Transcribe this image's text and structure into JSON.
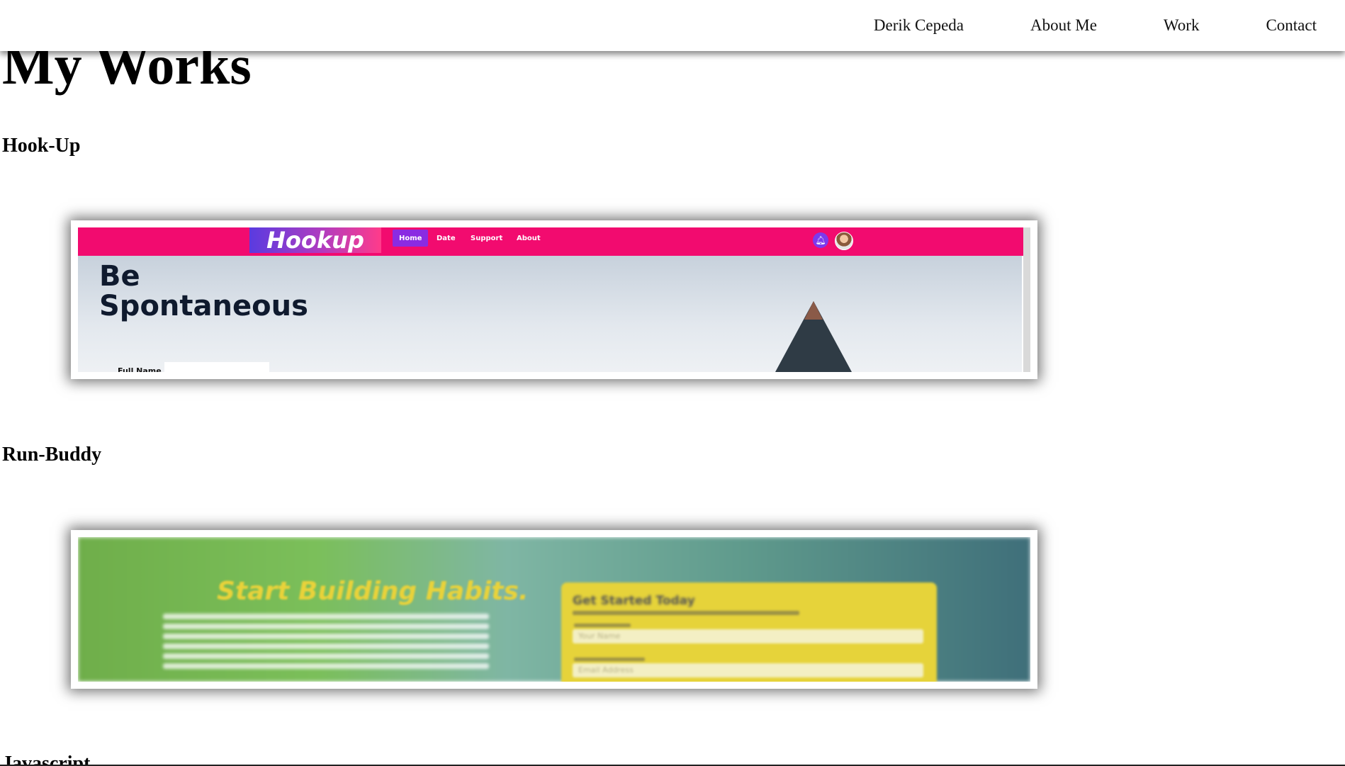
{
  "nav": {
    "links": [
      "Derik Cepeda",
      "About Me",
      "Work",
      "Contact"
    ]
  },
  "page": {
    "title": "My Works"
  },
  "projects": [
    {
      "name": "Hook-Up",
      "screenshot": {
        "logo": "Hookup",
        "nav": [
          "Home",
          "Date",
          "Support",
          "About"
        ],
        "active_nav": "Home",
        "headline_1": "Be",
        "headline_2": "Spontaneous",
        "field_label": "Full Name",
        "colors": {
          "header": "#f20b6f",
          "active_nav": "#8a2be2",
          "bell": "#7c3aed"
        },
        "icons": [
          "bell-icon",
          "avatar"
        ]
      }
    },
    {
      "name": "Run-Buddy",
      "screenshot": {
        "title": "Start Building Habits.",
        "form_title": "Get Started Today",
        "name_placeholder": "Your Name",
        "email_placeholder": "Email Address",
        "colors": {
          "title": "#e9d23a",
          "form_panel": "#e6d33a"
        }
      }
    },
    {
      "name": "Javascript"
    }
  ]
}
